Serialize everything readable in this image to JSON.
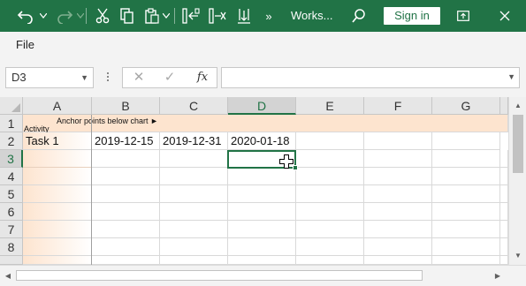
{
  "titlebar": {
    "title": "Works...",
    "sign_in_label": "Sign in",
    "icons": [
      "undo-icon",
      "redo-icon",
      "cut-icon",
      "copy-icon",
      "paste-icon",
      "insert-columns-icon",
      "delete-columns-icon",
      "freeze-panes-icon",
      "more-commands-icon",
      "search-icon",
      "restore-window-icon",
      "close-icon"
    ],
    "overflow_label": "»",
    "accent_color": "#217346"
  },
  "menu": {
    "file_label": "File"
  },
  "formula_bar": {
    "name_box": "D3",
    "cancel_icon": "✕",
    "enter_icon": "✓",
    "fx_label": "fx",
    "formula_value": ""
  },
  "grid": {
    "columns": [
      "A",
      "B",
      "C",
      "D",
      "E",
      "F",
      "G"
    ],
    "rows": [
      "1",
      "2",
      "3",
      "4",
      "5",
      "6",
      "7",
      "8"
    ],
    "selected_column": "D",
    "selected_row": "3",
    "row1_a_text": "Activity",
    "row1_anchor_text": "Anchor points below chart ►",
    "row2": [
      "Task 1",
      "2019-12-15",
      "2019-12-31",
      "2020-01-18"
    ],
    "header_fill_color": "#fde4cf",
    "selection_color": "#217346"
  }
}
